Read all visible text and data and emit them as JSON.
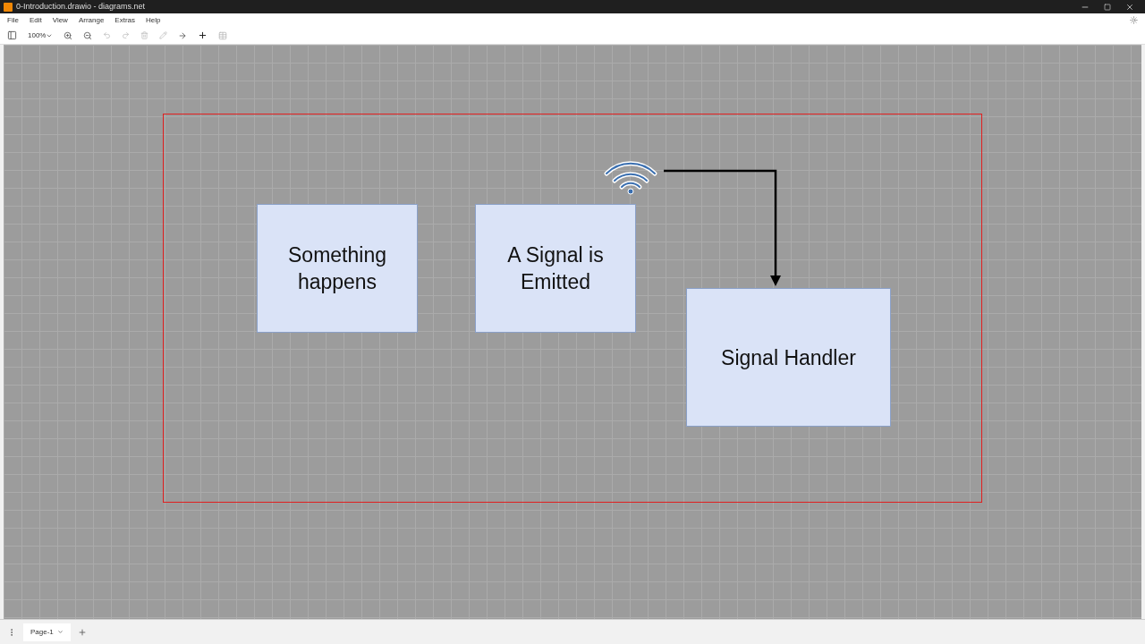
{
  "window": {
    "title": "0-Introduction.drawio - diagrams.net"
  },
  "menu": [
    "File",
    "Edit",
    "View",
    "Arrange",
    "Extras",
    "Help"
  ],
  "toolbar": {
    "zoom": "100%"
  },
  "diagram": {
    "nodes": [
      {
        "kind": "box",
        "label": "Something happens"
      },
      {
        "kind": "box",
        "label": "A Signal is Emitted"
      },
      {
        "kind": "box",
        "label": "Signal Handler"
      }
    ]
  },
  "pages": [
    {
      "label": "Page-1",
      "selected": true
    }
  ]
}
